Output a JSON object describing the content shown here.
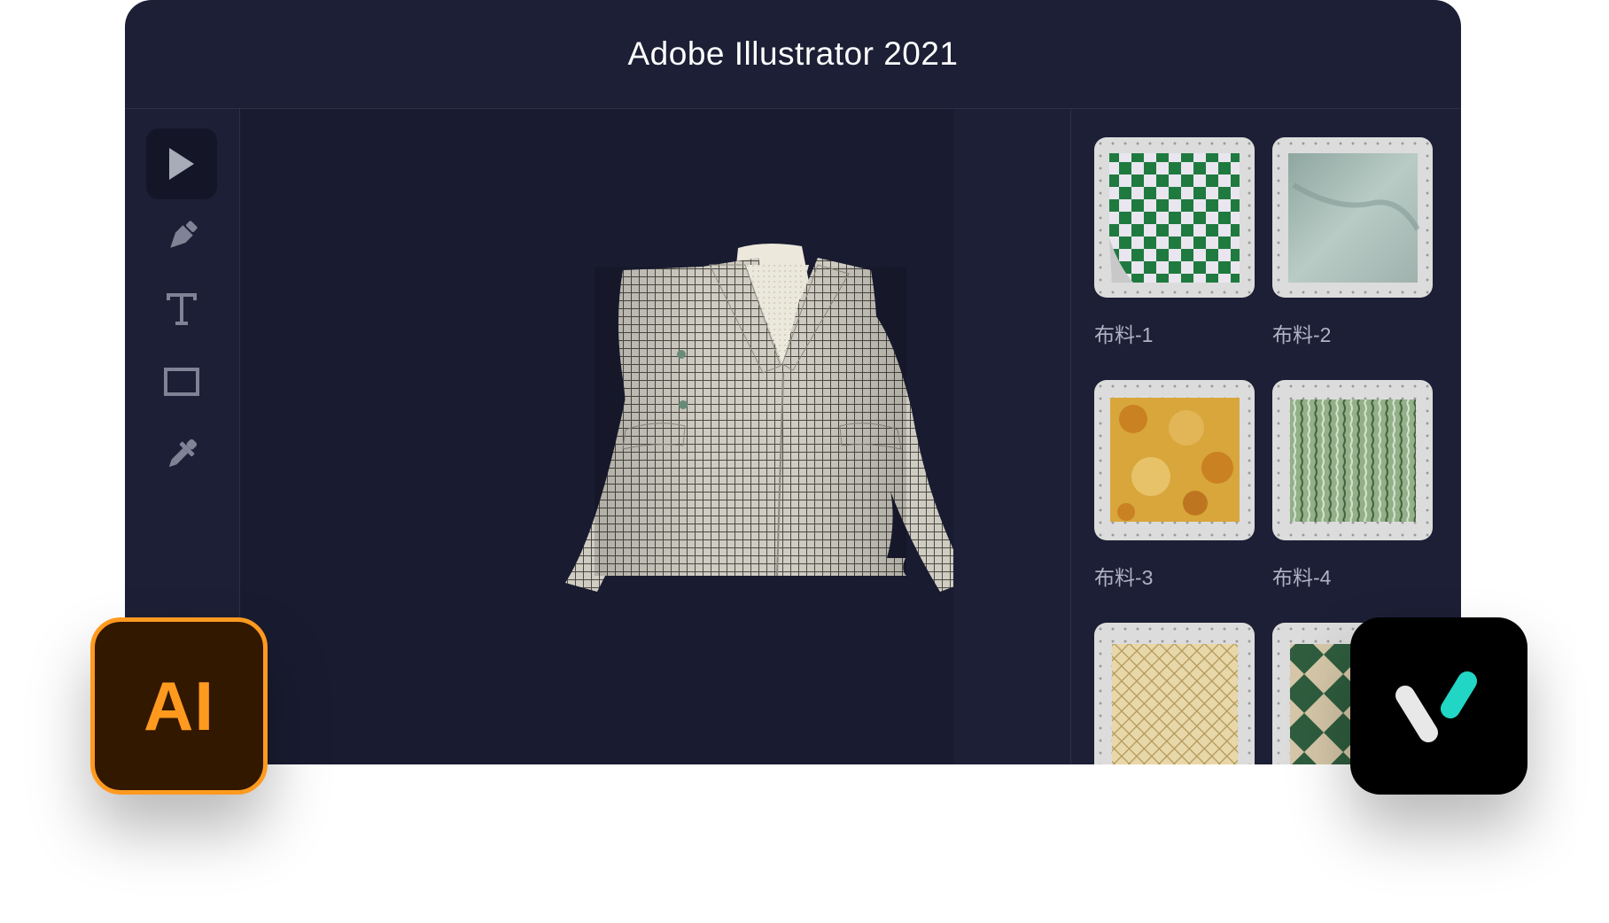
{
  "window": {
    "title": "Adobe Illustrator 2021"
  },
  "toolbar": {
    "tools": [
      {
        "icon": "selection-arrow-icon",
        "active": true
      },
      {
        "icon": "pen-tool-icon",
        "active": false
      },
      {
        "icon": "type-tool-icon",
        "active": false
      },
      {
        "icon": "rectangle-tool-icon",
        "active": false
      },
      {
        "icon": "eyedropper-icon",
        "active": false
      }
    ]
  },
  "canvas": {
    "artwork": "plaid-blazer-3d-garment"
  },
  "fabrics": {
    "items": [
      {
        "label": "布料-1",
        "pattern": "green-checkerboard"
      },
      {
        "label": "布料-2",
        "pattern": "sage-twill"
      },
      {
        "label": "布料-3",
        "pattern": "orange-floral"
      },
      {
        "label": "布料-4",
        "pattern": "green-wave"
      },
      {
        "label": "",
        "pattern": "gold-lattice"
      },
      {
        "label": "",
        "pattern": "green-harlequin"
      }
    ]
  },
  "badges": {
    "illustrator": {
      "text": "AI",
      "color": "#ff9a1f",
      "background": "#331800"
    },
    "vlogo": {
      "icon": "v-logo-icon",
      "accent": "#21d6c4"
    }
  },
  "colors": {
    "window_bg": "#1c1f35",
    "canvas_bg": "#191b30",
    "active_tool_bg": "#141628"
  }
}
